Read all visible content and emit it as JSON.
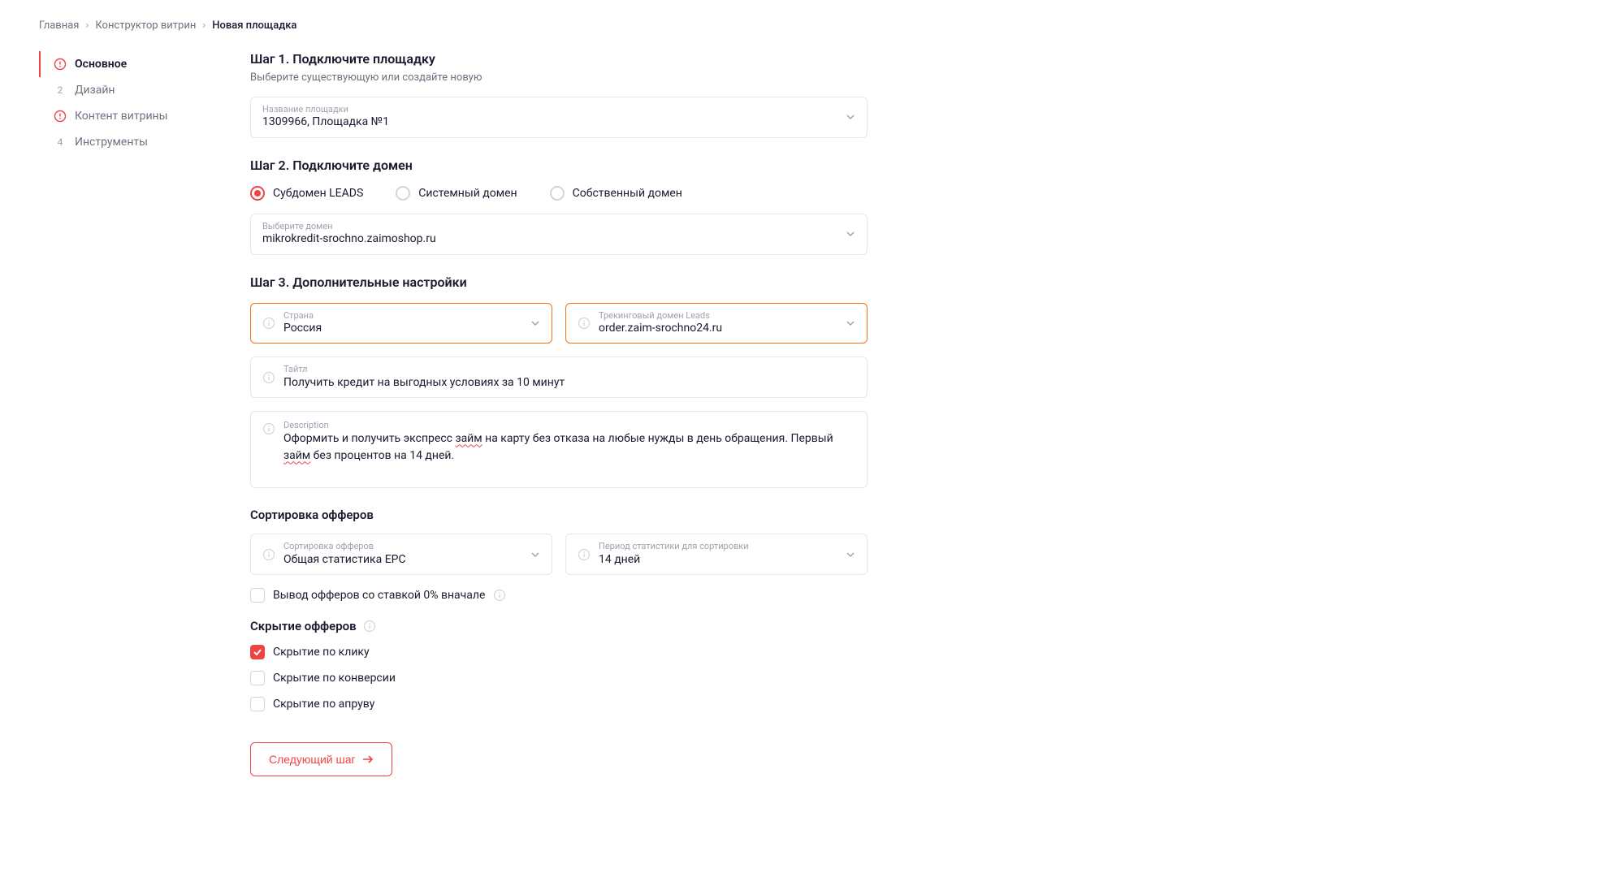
{
  "breadcrumb": {
    "items": [
      "Главная",
      "Конструктор витрин"
    ],
    "current": "Новая площадка"
  },
  "sidebar": {
    "items": [
      {
        "label": "Основное",
        "num": "",
        "warn": true,
        "active": true
      },
      {
        "label": "Дизайн",
        "num": "2",
        "warn": false,
        "active": false
      },
      {
        "label": "Контент витрины",
        "num": "",
        "warn": true,
        "active": false
      },
      {
        "label": "Инструменты",
        "num": "4",
        "warn": false,
        "active": false
      }
    ]
  },
  "step1": {
    "title": "Шаг 1. Подключите площадку",
    "sub": "Выберите существующую или создайте новую",
    "field_label": "Название площадки",
    "field_value": "1309966, Площадка №1"
  },
  "step2": {
    "title": "Шаг 2. Подключите домен",
    "radios": [
      "Субдомен LEADS",
      "Системный домен",
      "Собственный домен"
    ],
    "field_label": "Выберите домен",
    "field_value": "mikrokredit-srochno.zaimoshop.ru"
  },
  "step3": {
    "title": "Шаг 3. Дополнительные настройки",
    "country_label": "Страна",
    "country_value": "Россия",
    "tracking_label": "Трекинговый домен Leads",
    "tracking_value": "order.zaim-srochno24.ru",
    "title_label": "Тайтл",
    "title_value": "Получить кредит на выгодных условиях за 10 минут",
    "desc_label": "Description",
    "desc_p1": "Оформить и получить экспресс ",
    "desc_w1": "займ",
    "desc_p2": " на карту без отказа на любые нужды в день обращения. Первый ",
    "desc_w2": "займ",
    "desc_p3": " без процентов на 14 дней."
  },
  "sorting": {
    "title": "Сортировка офферов",
    "sort_label": "Сортировка офферов",
    "sort_value": "Общая статистика EPC",
    "period_label": "Период статистики для сортировки",
    "period_value": "14 дней",
    "zero_rate": "Вывод офферов со ставкой 0% вначале"
  },
  "hiding": {
    "title": "Скрытие офферов",
    "by_click": "Скрытие по клику",
    "by_conv": "Скрытие по конверсии",
    "by_approve": "Скрытие по апруву"
  },
  "next_button": "Следующий шаг"
}
